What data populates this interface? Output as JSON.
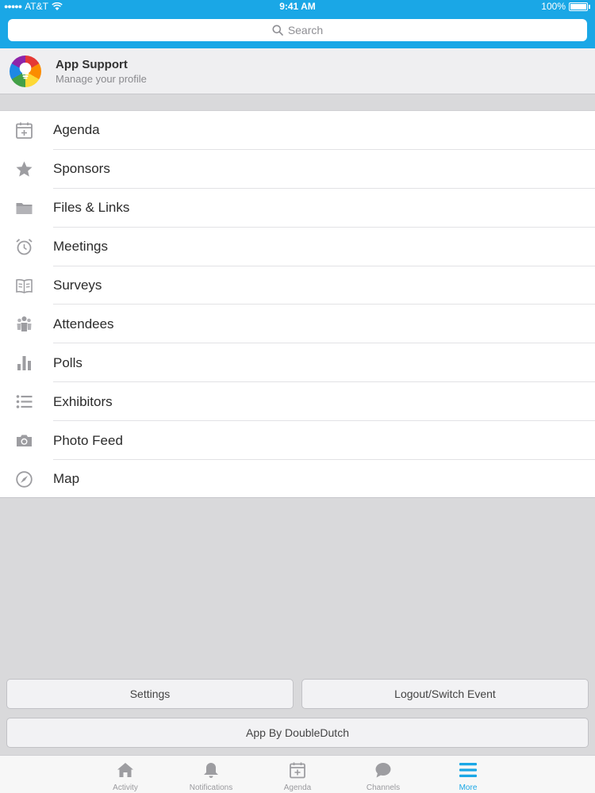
{
  "status": {
    "carrier": "AT&T",
    "time": "9:41 AM",
    "battery": "100%"
  },
  "search": {
    "placeholder": "Search"
  },
  "profile": {
    "name": "App Support",
    "subtitle": "Manage your profile"
  },
  "menu": {
    "items": [
      {
        "label": "Agenda",
        "icon": "calendar-icon"
      },
      {
        "label": "Sponsors",
        "icon": "star-icon"
      },
      {
        "label": "Files & Links",
        "icon": "folder-icon"
      },
      {
        "label": "Meetings",
        "icon": "alarm-clock-icon"
      },
      {
        "label": "Surveys",
        "icon": "book-icon"
      },
      {
        "label": "Attendees",
        "icon": "people-icon"
      },
      {
        "label": "Polls",
        "icon": "bar-chart-icon"
      },
      {
        "label": "Exhibitors",
        "icon": "list-icon"
      },
      {
        "label": "Photo Feed",
        "icon": "camera-icon"
      },
      {
        "label": "Map",
        "icon": "compass-icon"
      }
    ]
  },
  "buttons": {
    "settings": "Settings",
    "logout": "Logout/Switch Event",
    "credit": "App By DoubleDutch"
  },
  "tabs": [
    {
      "label": "Activity",
      "icon": "home-icon",
      "active": false
    },
    {
      "label": "Notifications",
      "icon": "bell-icon",
      "active": false
    },
    {
      "label": "Agenda",
      "icon": "calendar-icon",
      "active": false
    },
    {
      "label": "Channels",
      "icon": "chat-bubble-icon",
      "active": false
    },
    {
      "label": "More",
      "icon": "hamburger-icon",
      "active": true
    }
  ],
  "colors": {
    "accent": "#1aa7e6",
    "icon_gray": "#9d9da1",
    "background": "#d9d9db"
  }
}
